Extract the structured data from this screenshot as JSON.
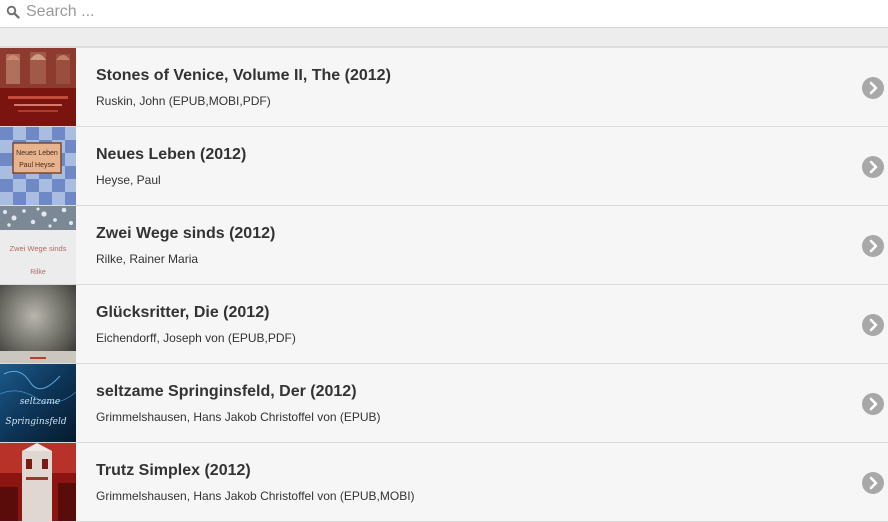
{
  "search": {
    "placeholder": "Search ...",
    "value": ""
  },
  "books": [
    {
      "title": "Stones of Venice, Volume II, The (2012)",
      "author": "Ruskin, John (EPUB,MOBI,PDF)",
      "cover_icon": "cover-red-architecture"
    },
    {
      "title": "Neues Leben (2012)",
      "author": "Heyse, Paul",
      "cover_icon": "cover-blue-checker",
      "cover_text": [
        "Neues Leben",
        "Paul Heyse"
      ]
    },
    {
      "title": "Zwei Wege sinds (2012)",
      "author": "Rilke, Rainer Maria",
      "cover_icon": "cover-white-texture",
      "cover_text": [
        "Zwei Wege sinds",
        "Rilke"
      ]
    },
    {
      "title": "Glücksritter, Die (2012)",
      "author": "Eichendorff, Joseph von (EPUB,PDF)",
      "cover_icon": "cover-dark-grey-texture"
    },
    {
      "title": "seltzame Springinsfeld, Der (2012)",
      "author": "Grimmelshausen, Hans Jakob Christoffel von (EPUB)",
      "cover_icon": "cover-blue-script",
      "cover_text": [
        "seltzame",
        "Springinsfeld"
      ]
    },
    {
      "title": "Trutz Simplex (2012)",
      "author": "Grimmelshausen, Hans Jakob Christoffel von (EPUB,MOBI)",
      "cover_icon": "cover-red-tower"
    }
  ],
  "colors": {
    "chevron_circle": "#a8a8a8",
    "row_background": "#f6f6f6",
    "text": "#333333"
  }
}
